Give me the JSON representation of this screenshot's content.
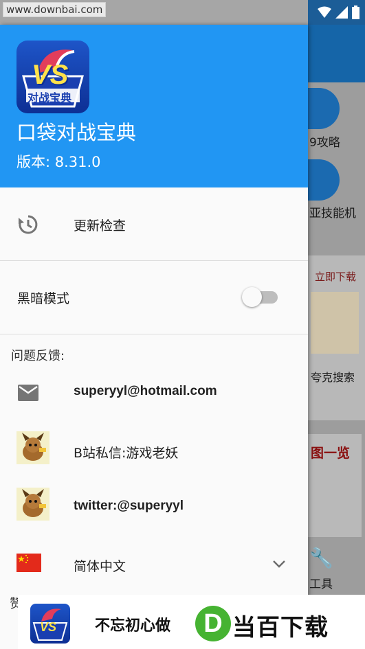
{
  "status_bar": {
    "watermark": "www.downbai.com"
  },
  "background": {
    "tile1_label": "9攻略",
    "tile2_label": "亚技能机",
    "banner_title": "立即下载",
    "banner_label": "夸克搜索",
    "list_title": "图一览",
    "tool_label": "工具"
  },
  "drawer": {
    "app_title": "口袋对战宝典",
    "version": "版本: 8.31.0",
    "logo_text": "VS",
    "logo_subtext": "对战宝典",
    "update_check": "更新检查",
    "dark_mode": "黑暗模式",
    "dark_mode_on": false,
    "feedback_section": "问题反馈:",
    "email": "superyyl@hotmail.com",
    "bilibili": "B站私信:游戏老妖",
    "twitter": "twitter:@superyyl",
    "language": "简体中文",
    "partial_section": "赞"
  },
  "ad": {
    "text": "不忘初心做",
    "brand": "当百下载",
    "brand_letter": "D"
  },
  "colors": {
    "primary": "#2196f3",
    "drawer_bg": "#fafafa",
    "brand_green": "#46b332"
  },
  "icons": {
    "update": "history-icon",
    "email": "email-icon",
    "expand": "chevron-down-icon",
    "flag": "china-flag-icon"
  }
}
